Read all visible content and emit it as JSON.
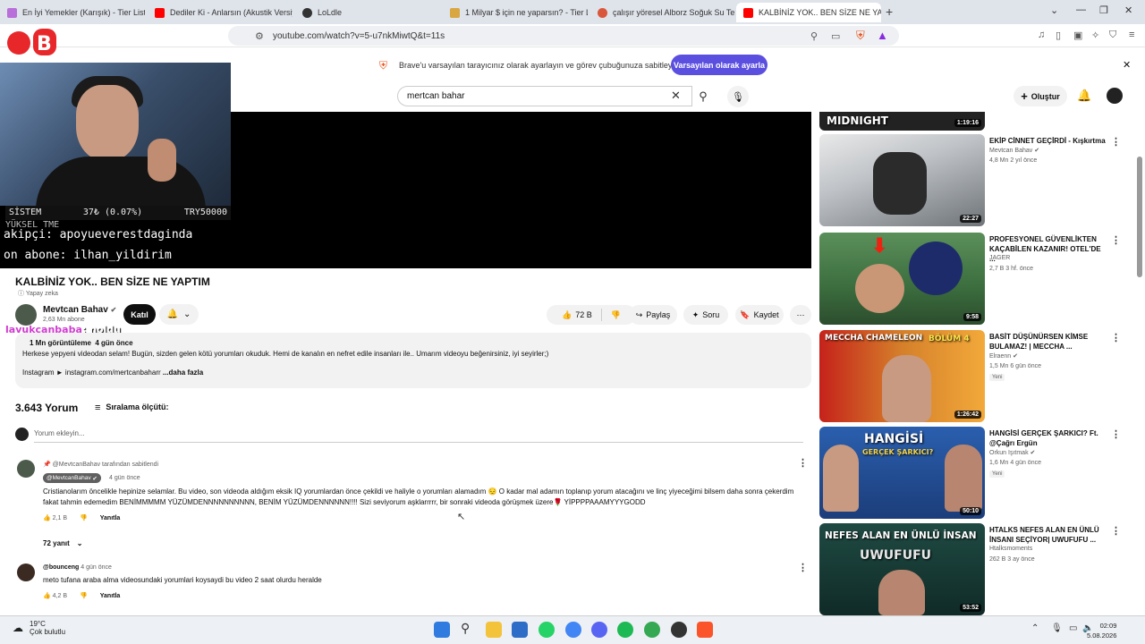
{
  "tabs": [
    {
      "label": "En İyi Yemekler (Karışık) - Tier List, Kı",
      "color": "#b86fd9"
    },
    {
      "label": "Dediler Ki - Anlarsın (Akustik Versiyo",
      "color": "#ff0000"
    },
    {
      "label": "LoLdle",
      "color": "#333333"
    },
    {
      "label": "1 Milyar $ için ne yaparsın? - Tier List",
      "color": "#d9a741"
    },
    {
      "label": "çalışır yöresel Alborz Soğuk Su Terme",
      "color": "#d9573b"
    },
    {
      "label": "KALBİNİZ YOK.. BEN SİZE NE YAP",
      "color": "#ff0000",
      "active": true
    }
  ],
  "address": {
    "url": "youtube.com/watch?v=5-u7nkMiwtQ&t=11s"
  },
  "banner": {
    "text": "Brave'u varsayılan tarayıcınız olarak ayarlayın ve görev çubuğunuza sabitleyin",
    "button": "Varsayılan olarak ayarla",
    "close": "✕"
  },
  "header": {
    "search_value": "mertcan bahar",
    "create_label": "Oluştur"
  },
  "stream": {
    "stats_label": "SİSTEM",
    "stats_value": "37₺ (0.07%)",
    "stats_goal": "TRY50000",
    "faded": "YÜKSEL TME",
    "line1": "akipçi: apoyueverestdaginda",
    "line2": "on abone: ilhan_yildirim",
    "overlay_user": "lavukcanbaba",
    "overlay_msg": ": noldu"
  },
  "video": {
    "title": "KALBİNİZ YOK.. BEN SİZE NE YAPTIM",
    "ai_label": "Yapay zeka",
    "channel": "Mevtcan Bahav",
    "subs": "2,63 Mn abone",
    "join": "Katıl",
    "likes": "72 B",
    "share": "Paylaş",
    "ask": "Soru",
    "save": "Kaydet",
    "views": "1 Mn görüntüleme",
    "age": "4 gün önce",
    "description": "Herkese yepyeni videodan selam! Bugün, sizden gelen kötü yorumları okuduk. Hemi de kanalın en nefret edile insanları ile.. Umarım videoyu beğenirsiniz, iyi seyirler;)",
    "instagram": "Instagram ► instagram.com/mertcanbaharr",
    "more": "...daha fazla"
  },
  "comments": {
    "count": "3.643 Yorum",
    "sort_label": "Sıralama ölçütü:",
    "add_placeholder": "Yorum ekleyin...",
    "items": [
      {
        "pinned_by": "@MevtcanBahav tarafından sabitlendi",
        "author": "@MevtcanBahav",
        "time": "4 gün önce",
        "text": "Cristianolarım öncelikle hepinize selamlar. Bu video, son videoda aldığım eksik IQ yorumlardan önce çekildi ve haliyle o yorumları alamadım 😔 O kadar mal adamın toplanıp yorum atacağını ve linç yiyeceğimi bilsem daha sonra çekerdim fakat tahmin edemedim BENİMMMMM YÜZÜMDENNNNNNNNNN, BENİM YÜZÜMDENNNNNN!!!! Sizi seviyorum aşklarrrrr, bir sonraki videoda görüşmek üzere🌹 YİPPPPAAAMYYYGODD",
        "likes": "2,1 B",
        "reply": "Yanıtla",
        "replies": "72 yanıt"
      },
      {
        "author": "@bounceng",
        "time": "4 gün önce",
        "text": "meto tufana araba alma videosundaki yorumlari koysaydi bu video 2 saat olurdu heralde",
        "likes": "4,2 B",
        "reply": "Yanıtla"
      }
    ]
  },
  "sidebar": [
    {
      "title": "",
      "channel": "",
      "meta": "",
      "duration": "1:19:16",
      "thumb_text": "MIDNIGHT"
    },
    {
      "title": "EKİP CİNNET GEÇİRDİ - Kışkırtma",
      "channel": "Mevtcan Bahav",
      "meta": "4,8 Mn  2 yıl önce",
      "duration": "22:27",
      "thumb_text": ""
    },
    {
      "title": "PROFESYONEL GÜVENLİKTEN KAÇABİLEN KAZANIR! OTEL'DE ...",
      "channel": "JAGER",
      "meta": "2,7 B  3 hf. önce",
      "duration": "9:58",
      "thumb_text": ""
    },
    {
      "title": "BASİT DÜŞÜNÜRSEN KİMSE BULAMAZ! | MECCHA ...",
      "channel": "Elraenn",
      "meta": "1,5 Mn  6 gün önce",
      "badge": "Yeni",
      "duration": "1:26:42",
      "thumb_text": "MECCHA CHAMELEON",
      "thumb_text2": "BÖLÜM 4"
    },
    {
      "title": "HANGİSİ GERÇEK ŞARKICI? Ft. @Çağrı Ergün",
      "channel": "Orkun Işıtmak",
      "meta": "1,6 Mn  4 gün önce",
      "badge": "Yeni",
      "duration": "50:10",
      "thumb_text": "HANGİSİ",
      "thumb_text2": "GERÇEK ŞARKICI?"
    },
    {
      "title": "HTALKS NEFES ALAN EN ÜNLÜ İNSANI SEÇİYOR| UWUFUFU ...",
      "channel": "Htalksmoments",
      "meta": "262 B  3 ay önce",
      "duration": "53:52",
      "thumb_text": "NEFES ALAN EN ÜNLÜ İNSAN",
      "thumb_text2": "UWUFUFU"
    }
  ],
  "taskbar": {
    "temp": "19°C",
    "weather": "Çok bulutlu",
    "time": "02:09",
    "date": "5.08.2026"
  }
}
